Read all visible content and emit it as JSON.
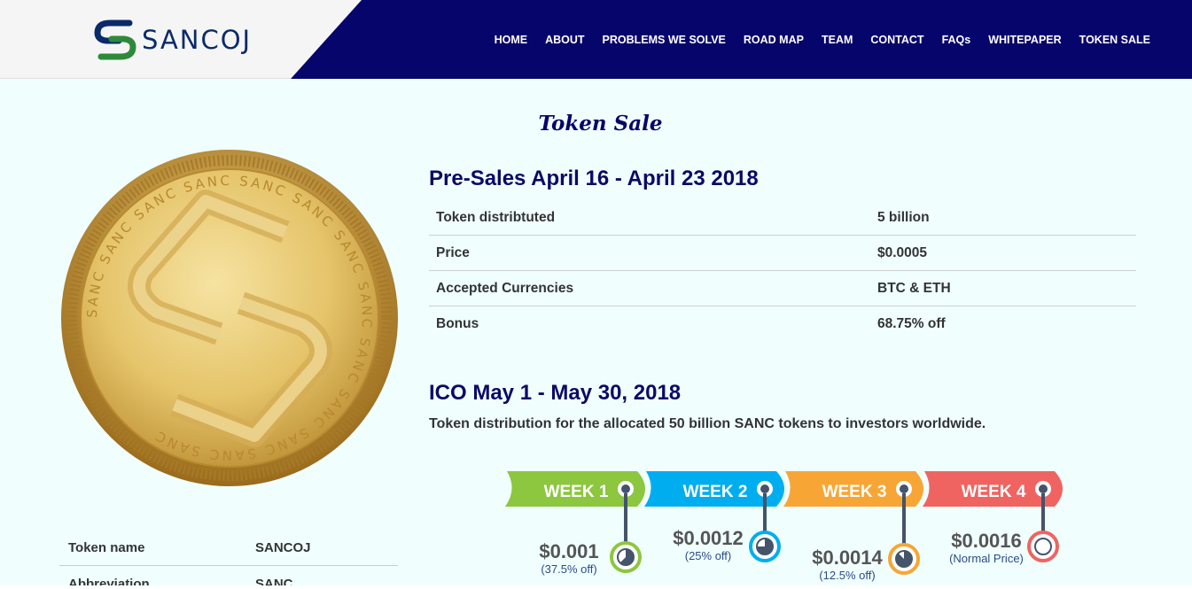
{
  "brand": {
    "name": "SANCOJ"
  },
  "nav": [
    {
      "label": "HOME"
    },
    {
      "label": "ABOUT"
    },
    {
      "label": "PROBLEMS WE SOLVE"
    },
    {
      "label": "ROAD MAP"
    },
    {
      "label": "TEAM"
    },
    {
      "label": "CONTACT"
    },
    {
      "label": "FAQs"
    },
    {
      "label": "WHITEPAPER"
    },
    {
      "label": "TOKEN SALE"
    }
  ],
  "page_title": "Token Sale",
  "coin": {
    "text": "SANC"
  },
  "left_table": [
    {
      "k": "Token name",
      "v": "SANCOJ"
    },
    {
      "k": "Abbreviation",
      "v": "SANC"
    }
  ],
  "presale": {
    "title": "Pre-Sales April 16 - April 23 2018",
    "rows": [
      {
        "k": "Token distribtuted",
        "v": "5 billion"
      },
      {
        "k": "Price",
        "v": "$0.0005"
      },
      {
        "k": "Accepted Currencies",
        "v": "BTC & ETH"
      },
      {
        "k": "Bonus",
        "v": "68.75% off"
      }
    ]
  },
  "ico": {
    "title": "ICO May 1 - May 30, 2018",
    "desc": "Token distribution for the allocated 50 billion SANC tokens to investors worldwide.",
    "weeks": [
      {
        "label": "WEEK 1",
        "price": "$0.001",
        "note": "(37.5% off)",
        "color": "#8dc63f",
        "discount_fraction": 0.375
      },
      {
        "label": "WEEK 2",
        "price": "$0.0012",
        "note": "(25% off)",
        "color": "#00aeef",
        "discount_fraction": 0.25
      },
      {
        "label": "WEEK 3",
        "price": "$0.0014",
        "note": "(12.5% off)",
        "color": "#f7a635",
        "discount_fraction": 0.125
      },
      {
        "label": "WEEK 4",
        "price": "$0.0016",
        "note": "(Normal Price)",
        "color": "#ef6461",
        "discount_fraction": 0
      }
    ]
  }
}
